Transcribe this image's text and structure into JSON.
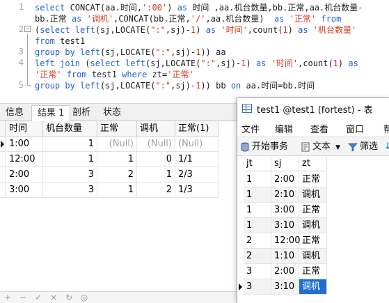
{
  "editor": {
    "line_numbers": [
      "1",
      "2",
      "3",
      "4",
      "5"
    ],
    "lines": [
      {
        "n": 1,
        "tokens": [
          {
            "t": "kw",
            "v": "select "
          },
          {
            "t": "txt",
            "v": "CONCAT(aa.时间,"
          },
          {
            "t": "str",
            "v": "':00'"
          },
          {
            "t": "txt",
            "v": ") "
          },
          {
            "t": "kw",
            "v": "as "
          },
          {
            "t": "txt",
            "v": "时间 ,aa.机台数量,bb.正常,aa.机台数量-"
          }
        ]
      },
      {
        "n": null,
        "tokens": [
          {
            "t": "txt",
            "v": "bb.正常 "
          },
          {
            "t": "kw",
            "v": "as "
          },
          {
            "t": "str",
            "v": "'调机'"
          },
          {
            "t": "txt",
            "v": ",CONCAT(bb.正常,"
          },
          {
            "t": "str",
            "v": "'/'"
          },
          {
            "t": "txt",
            "v": ",aa.机台数量)  "
          },
          {
            "t": "kw",
            "v": "as "
          },
          {
            "t": "str",
            "v": "'正常' "
          },
          {
            "t": "kw",
            "v": "from"
          }
        ]
      },
      {
        "n": 2,
        "tokens": [
          {
            "t": "txt",
            "v": "("
          },
          {
            "t": "kw",
            "v": "select left"
          },
          {
            "t": "txt",
            "v": "(sj,LOCATE("
          },
          {
            "t": "str",
            "v": "\":\""
          },
          {
            "t": "txt",
            "v": ",sj)-"
          },
          {
            "t": "str",
            "v": "1"
          },
          {
            "t": "txt",
            "v": ") "
          },
          {
            "t": "kw",
            "v": "as "
          },
          {
            "t": "str",
            "v": "'时间'"
          },
          {
            "t": "txt",
            "v": ",count("
          },
          {
            "t": "str",
            "v": "1"
          },
          {
            "t": "txt",
            "v": ") "
          },
          {
            "t": "kw",
            "v": "as "
          },
          {
            "t": "str",
            "v": "'机台数量'"
          }
        ]
      },
      {
        "n": null,
        "tokens": [
          {
            "t": "kw",
            "v": "from "
          },
          {
            "t": "txt",
            "v": "test1"
          }
        ]
      },
      {
        "n": 3,
        "tokens": [
          {
            "t": "kw",
            "v": "group by left"
          },
          {
            "t": "txt",
            "v": "(sj,LOCATE("
          },
          {
            "t": "str",
            "v": "\":\""
          },
          {
            "t": "txt",
            "v": ",sj)-"
          },
          {
            "t": "str",
            "v": "1"
          },
          {
            "t": "txt",
            "v": ")) aa"
          }
        ]
      },
      {
        "n": 4,
        "tokens": [
          {
            "t": "kw",
            "v": "left join "
          },
          {
            "t": "txt",
            "v": "("
          },
          {
            "t": "kw",
            "v": "select left"
          },
          {
            "t": "txt",
            "v": "(sj,LOCATE("
          },
          {
            "t": "str",
            "v": "\":\""
          },
          {
            "t": "txt",
            "v": ",sj)-"
          },
          {
            "t": "str",
            "v": "1"
          },
          {
            "t": "txt",
            "v": ") "
          },
          {
            "t": "kw",
            "v": "as "
          },
          {
            "t": "str",
            "v": "'时间'"
          },
          {
            "t": "txt",
            "v": ",count("
          },
          {
            "t": "str",
            "v": "1"
          },
          {
            "t": "txt",
            "v": ") "
          },
          {
            "t": "kw",
            "v": "as"
          }
        ]
      },
      {
        "n": null,
        "tokens": [
          {
            "t": "str",
            "v": "'正常' "
          },
          {
            "t": "kw",
            "v": "from "
          },
          {
            "t": "txt",
            "v": "test1 "
          },
          {
            "t": "kw",
            "v": "where "
          },
          {
            "t": "txt",
            "v": "zt="
          },
          {
            "t": "str",
            "v": "'正常'"
          }
        ]
      },
      {
        "n": 5,
        "tokens": [
          {
            "t": "kw",
            "v": "group by left"
          },
          {
            "t": "txt",
            "v": "(sj,LOCATE("
          },
          {
            "t": "str",
            "v": "\":\""
          },
          {
            "t": "txt",
            "v": ",sj)-"
          },
          {
            "t": "str",
            "v": "1"
          },
          {
            "t": "txt",
            "v": ")) bb "
          },
          {
            "t": "kw",
            "v": "on "
          },
          {
            "t": "txt",
            "v": "aa.时间=bb.时间"
          }
        ]
      }
    ]
  },
  "result_tabs": [
    {
      "label": "信息",
      "active": false
    },
    {
      "label": "结果 1",
      "active": true
    },
    {
      "label": "剖析",
      "active": false
    },
    {
      "label": "状态",
      "active": false
    }
  ],
  "result_grid": {
    "columns": [
      "时间",
      "机台数量",
      "正常",
      "调机",
      "正常(1)"
    ],
    "rows": [
      [
        "1:00",
        "1",
        "(Null)",
        "(Null)",
        "(Null)"
      ],
      [
        "12:00",
        "1",
        "1",
        "0",
        "1/1"
      ],
      [
        "2:00",
        "3",
        "2",
        "1",
        "2/3"
      ],
      [
        "3:00",
        "3",
        "1",
        "2",
        "1/3"
      ]
    ]
  },
  "footer_buttons": [
    "+",
    "−",
    "✓",
    "×",
    "↻",
    "◎"
  ],
  "table_window": {
    "title": "test1 @test1 (fortest) - 表",
    "menu": [
      "文件",
      "编辑",
      "查看",
      "窗口",
      "帮"
    ],
    "toolbar": {
      "begin_transaction": "开始事务",
      "text": "文本",
      "filter": "筛选"
    },
    "columns": [
      "jt",
      "sj",
      "zt"
    ],
    "rows": [
      [
        "1",
        "2:00",
        "正常"
      ],
      [
        "1",
        "2:10",
        "调机"
      ],
      [
        "1",
        "3:00",
        "正常"
      ],
      [
        "1",
        "3:10",
        "调机"
      ],
      [
        "2",
        "12:00",
        "正常"
      ],
      [
        "2",
        "1:10",
        "调机"
      ],
      [
        "3",
        "2:00",
        "正常"
      ],
      [
        "3",
        "3:10",
        "调机"
      ]
    ]
  }
}
